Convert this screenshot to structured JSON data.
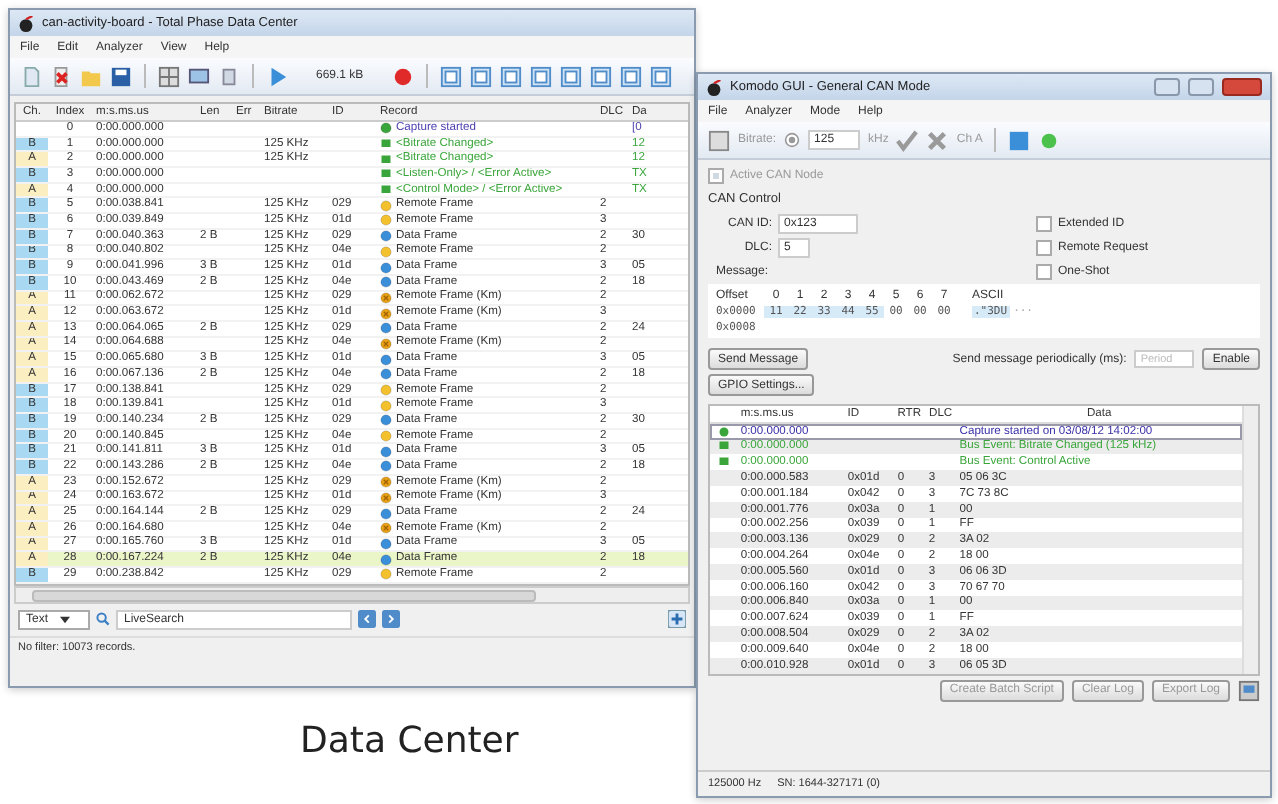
{
  "data_center": {
    "title": "can-activity-board - Total Phase Data Center",
    "menu": [
      "File",
      "Edit",
      "Analyzer",
      "View",
      "Help"
    ],
    "toolbar_size": "669.1 kB",
    "columns": [
      "Ch.",
      "Index",
      "m:s.ms.us",
      "Len",
      "Err",
      "Bitrate",
      "ID",
      "Record",
      "DLC",
      "Da"
    ],
    "rows": [
      {
        "index": "0",
        "time": "0:00.000.000",
        "record": "Capture started",
        "kind": "capture",
        "data": "[0",
        "selected": false
      },
      {
        "ch": "B",
        "color": "#a9d9f2",
        "index": "1",
        "time": "0:00.000.000",
        "bitrate": "125 KHz",
        "record": "<Bitrate Changed>",
        "kind": "event",
        "data": "12",
        "selected": false
      },
      {
        "ch": "A",
        "color": "#fbeec0",
        "index": "2",
        "time": "0:00.000.000",
        "bitrate": "125 KHz",
        "record": "<Bitrate Changed>",
        "kind": "event",
        "data": "12",
        "selected": false
      },
      {
        "ch": "B",
        "color": "#a9d9f2",
        "index": "3",
        "time": "0:00.000.000",
        "record": "<Listen-Only> / <Error Active>",
        "kind": "event",
        "data": "TX",
        "selected": false
      },
      {
        "ch": "A",
        "color": "#fbeec0",
        "index": "4",
        "time": "0:00.000.000",
        "record": "<Control Mode> / <Error Active>",
        "kind": "event",
        "data": "TX",
        "selected": false
      },
      {
        "ch": "B",
        "color": "#a9d9f2",
        "index": "5",
        "time": "0:00.038.841",
        "bitrate": "125 KHz",
        "id": "029",
        "record": "Remote Frame",
        "kind": "remote",
        "dlc": "2",
        "selected": false
      },
      {
        "ch": "B",
        "color": "#a9d9f2",
        "index": "6",
        "time": "0:00.039.849",
        "bitrate": "125 KHz",
        "id": "01d",
        "record": "Remote Frame",
        "kind": "remote",
        "dlc": "3",
        "selected": false
      },
      {
        "ch": "B",
        "color": "#a9d9f2",
        "index": "7",
        "time": "0:00.040.363",
        "len": "2 B",
        "bitrate": "125 KHz",
        "id": "029",
        "record": "Data Frame",
        "kind": "data",
        "dlc": "2",
        "data": "30",
        "selected": false
      },
      {
        "ch": "B",
        "color": "#a9d9f2",
        "index": "8",
        "time": "0:00.040.802",
        "bitrate": "125 KHz",
        "id": "04e",
        "record": "Remote Frame",
        "kind": "remote",
        "dlc": "2",
        "selected": false
      },
      {
        "ch": "B",
        "color": "#a9d9f2",
        "index": "9",
        "time": "0:00.041.996",
        "len": "3 B",
        "bitrate": "125 KHz",
        "id": "01d",
        "record": "Data Frame",
        "kind": "data",
        "dlc": "3",
        "data": "05",
        "selected": false
      },
      {
        "ch": "B",
        "color": "#a9d9f2",
        "index": "10",
        "time": "0:00.043.469",
        "len": "2 B",
        "bitrate": "125 KHz",
        "id": "04e",
        "record": "Data Frame",
        "kind": "data",
        "dlc": "2",
        "data": "18",
        "selected": false
      },
      {
        "ch": "A",
        "color": "#fbeec0",
        "index": "11",
        "time": "0:00.062.672",
        "bitrate": "125 KHz",
        "id": "029",
        "record": "Remote Frame (Km)",
        "kind": "remote_km",
        "dlc": "2",
        "selected": false
      },
      {
        "ch": "A",
        "color": "#fbeec0",
        "index": "12",
        "time": "0:00.063.672",
        "bitrate": "125 KHz",
        "id": "01d",
        "record": "Remote Frame (Km)",
        "kind": "remote_km",
        "dlc": "3",
        "selected": false
      },
      {
        "ch": "A",
        "color": "#fbeec0",
        "index": "13",
        "time": "0:00.064.065",
        "len": "2 B",
        "bitrate": "125 KHz",
        "id": "029",
        "record": "Data Frame",
        "kind": "data",
        "dlc": "2",
        "data": "24",
        "selected": false
      },
      {
        "ch": "A",
        "color": "#fbeec0",
        "index": "14",
        "time": "0:00.064.688",
        "bitrate": "125 KHz",
        "id": "04e",
        "record": "Remote Frame (Km)",
        "kind": "remote_km",
        "dlc": "2",
        "selected": false
      },
      {
        "ch": "A",
        "color": "#fbeec0",
        "index": "15",
        "time": "0:00.065.680",
        "len": "3 B",
        "bitrate": "125 KHz",
        "id": "01d",
        "record": "Data Frame",
        "kind": "data",
        "dlc": "3",
        "data": "05",
        "selected": false
      },
      {
        "ch": "A",
        "color": "#fbeec0",
        "index": "16",
        "time": "0:00.067.136",
        "len": "2 B",
        "bitrate": "125 KHz",
        "id": "04e",
        "record": "Data Frame",
        "kind": "data",
        "dlc": "2",
        "data": "18",
        "selected": false
      },
      {
        "ch": "B",
        "color": "#a9d9f2",
        "index": "17",
        "time": "0:00.138.841",
        "bitrate": "125 KHz",
        "id": "029",
        "record": "Remote Frame",
        "kind": "remote",
        "dlc": "2",
        "selected": false
      },
      {
        "ch": "B",
        "color": "#a9d9f2",
        "index": "18",
        "time": "0:00.139.841",
        "bitrate": "125 KHz",
        "id": "01d",
        "record": "Remote Frame",
        "kind": "remote",
        "dlc": "3",
        "selected": false
      },
      {
        "ch": "B",
        "color": "#a9d9f2",
        "index": "19",
        "time": "0:00.140.234",
        "len": "2 B",
        "bitrate": "125 KHz",
        "id": "029",
        "record": "Data Frame",
        "kind": "data",
        "dlc": "2",
        "data": "30",
        "selected": false
      },
      {
        "ch": "B",
        "color": "#a9d9f2",
        "index": "20",
        "time": "0:00.140.845",
        "bitrate": "125 KHz",
        "id": "04e",
        "record": "Remote Frame",
        "kind": "remote",
        "dlc": "2",
        "selected": false
      },
      {
        "ch": "B",
        "color": "#a9d9f2",
        "index": "21",
        "time": "0:00.141.811",
        "len": "3 B",
        "bitrate": "125 KHz",
        "id": "01d",
        "record": "Data Frame",
        "kind": "data",
        "dlc": "3",
        "data": "05",
        "selected": false
      },
      {
        "ch": "B",
        "color": "#a9d9f2",
        "index": "22",
        "time": "0:00.143.286",
        "len": "2 B",
        "bitrate": "125 KHz",
        "id": "04e",
        "record": "Data Frame",
        "kind": "data",
        "dlc": "2",
        "data": "18",
        "selected": false
      },
      {
        "ch": "A",
        "color": "#fbeec0",
        "index": "23",
        "time": "0:00.152.672",
        "bitrate": "125 KHz",
        "id": "029",
        "record": "Remote Frame (Km)",
        "kind": "remote_km",
        "dlc": "2",
        "selected": false
      },
      {
        "ch": "A",
        "color": "#fbeec0",
        "index": "24",
        "time": "0:00.163.672",
        "bitrate": "125 KHz",
        "id": "01d",
        "record": "Remote Frame (Km)",
        "kind": "remote_km",
        "dlc": "3",
        "selected": false
      },
      {
        "ch": "A",
        "color": "#fbeec0",
        "index": "25",
        "time": "0:00.164.144",
        "len": "2 B",
        "bitrate": "125 KHz",
        "id": "029",
        "record": "Data Frame",
        "kind": "data",
        "dlc": "2",
        "data": "24",
        "selected": false
      },
      {
        "ch": "A",
        "color": "#fbeec0",
        "index": "26",
        "time": "0:00.164.680",
        "bitrate": "125 KHz",
        "id": "04e",
        "record": "Remote Frame (Km)",
        "kind": "remote_km",
        "dlc": "2",
        "selected": false
      },
      {
        "ch": "A",
        "color": "#fbeec0",
        "index": "27",
        "time": "0:00.165.760",
        "len": "3 B",
        "bitrate": "125 KHz",
        "id": "01d",
        "record": "Data Frame",
        "kind": "data",
        "dlc": "3",
        "data": "05",
        "selected": false
      },
      {
        "ch": "A",
        "color": "#fbeec0",
        "index": "28",
        "time": "0:00.167.224",
        "len": "2 B",
        "bitrate": "125 KHz",
        "id": "04e",
        "record": "Data Frame",
        "kind": "data",
        "dlc": "2",
        "data": "18",
        "selected": true
      },
      {
        "ch": "B",
        "color": "#a9d9f2",
        "index": "29",
        "time": "0:00.238.842",
        "bitrate": "125 KHz",
        "id": "029",
        "record": "Remote Frame",
        "kind": "remote",
        "dlc": "2",
        "selected": false
      }
    ],
    "search": {
      "type": "Text",
      "value": "LiveSearch"
    },
    "status": "No filter: 10073 records."
  },
  "komodo": {
    "title": "Komodo GUI - General CAN Mode",
    "menu": [
      "File",
      "Analyzer",
      "Mode",
      "Help"
    ],
    "toolbar": {
      "bitrate_label": "Bitrate:",
      "radio": {
        "selected": true
      },
      "bitrate": "125",
      "unit": "kHz",
      "channel": "Ch A"
    },
    "active_node": {
      "label": "Active CAN Node",
      "checked": true
    },
    "section": "CAN Control",
    "can_id": {
      "label": "CAN ID:",
      "value": "0x123"
    },
    "dlc": {
      "label": "DLC:",
      "value": "5"
    },
    "options": [
      {
        "label": "Extended ID",
        "checked": false
      },
      {
        "label": "Remote Request",
        "checked": false
      },
      {
        "label": "One-Shot",
        "checked": false
      }
    ],
    "message": {
      "label": "Message:",
      "offset_label": "Offset",
      "columns": [
        "0",
        "1",
        "2",
        "3",
        "4",
        "5",
        "6",
        "7"
      ],
      "ascii_label": "ASCII",
      "lines": [
        {
          "offset": "0x0000",
          "bytes": [
            "11",
            "22",
            "33",
            "44",
            "55",
            "00",
            "00",
            "00"
          ],
          "ascii": ".\"3DU",
          "more": "···"
        },
        {
          "offset": "0x0008"
        }
      ]
    },
    "send_button": "Send Message",
    "periodic_label": "Send message periodically (ms):",
    "period": {
      "placeholder": "Period"
    },
    "enable_button": "Enable",
    "gpio_button": "GPIO Settings...",
    "log_columns": [
      "m:s.ms.us",
      "ID",
      "RTR",
      "DLC",
      "Data"
    ],
    "log": [
      {
        "kind": "capture",
        "time": "0:00.000.000",
        "data": "Capture started on 03/08/12 14:02:00"
      },
      {
        "kind": "event",
        "time": "0:00.000.000",
        "data": "Bus Event: Bitrate Changed (125 kHz)"
      },
      {
        "kind": "event",
        "time": "0:00.000.000",
        "data": "Bus Event: Control Active"
      },
      {
        "kind": "frame",
        "time": "0:00.000.583",
        "id": "0x01d",
        "rtr": "0",
        "dlc": "3",
        "data": "05 06 3C"
      },
      {
        "kind": "frame",
        "time": "0:00.001.184",
        "id": "0x042",
        "rtr": "0",
        "dlc": "3",
        "data": "7C 73 8C"
      },
      {
        "kind": "frame",
        "time": "0:00.001.776",
        "id": "0x03a",
        "rtr": "0",
        "dlc": "1",
        "data": "00"
      },
      {
        "kind": "frame",
        "time": "0:00.002.256",
        "id": "0x039",
        "rtr": "0",
        "dlc": "1",
        "data": "FF"
      },
      {
        "kind": "frame",
        "time": "0:00.003.136",
        "id": "0x029",
        "rtr": "0",
        "dlc": "2",
        "data": "3A 02"
      },
      {
        "kind": "frame",
        "time": "0:00.004.264",
        "id": "0x04e",
        "rtr": "0",
        "dlc": "2",
        "data": "18 00"
      },
      {
        "kind": "frame",
        "time": "0:00.005.560",
        "id": "0x01d",
        "rtr": "0",
        "dlc": "3",
        "data": "06 06 3D"
      },
      {
        "kind": "frame",
        "time": "0:00.006.160",
        "id": "0x042",
        "rtr": "0",
        "dlc": "3",
        "data": "70 67 70"
      },
      {
        "kind": "frame",
        "time": "0:00.006.840",
        "id": "0x03a",
        "rtr": "0",
        "dlc": "1",
        "data": "00"
      },
      {
        "kind": "frame",
        "time": "0:00.007.624",
        "id": "0x039",
        "rtr": "0",
        "dlc": "1",
        "data": "FF"
      },
      {
        "kind": "frame",
        "time": "0:00.008.504",
        "id": "0x029",
        "rtr": "0",
        "dlc": "2",
        "data": "3A 02"
      },
      {
        "kind": "frame",
        "time": "0:00.009.640",
        "id": "0x04e",
        "rtr": "0",
        "dlc": "2",
        "data": "18 00"
      },
      {
        "kind": "frame",
        "time": "0:00.010.928",
        "id": "0x01d",
        "rtr": "0",
        "dlc": "3",
        "data": "06 05 3D"
      }
    ],
    "log_buttons": [
      "Create Batch Script",
      "Clear Log",
      "Export Log"
    ],
    "status": [
      "125000 Hz",
      "SN: 1644-327171 (0)"
    ]
  },
  "caption": "Data Center"
}
